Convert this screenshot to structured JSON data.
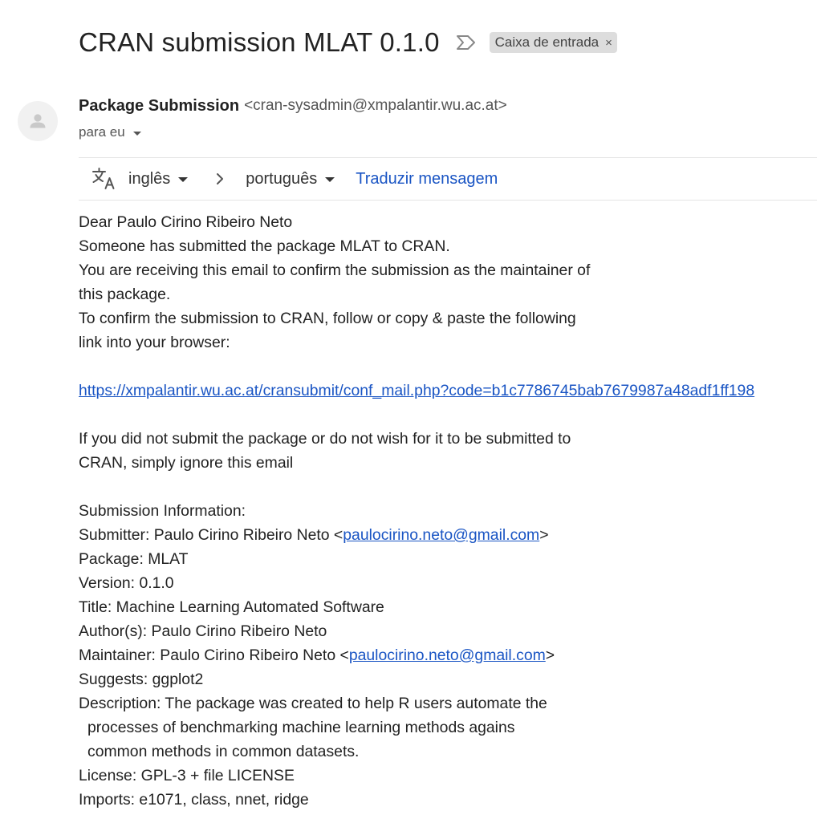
{
  "email": {
    "subject": "CRAN submission MLAT 0.1.0",
    "label": "Caixa de entrada",
    "label_remove_glyph": "×",
    "sender": {
      "name": "Package Submission",
      "email": "<cran-sysadmin@xmpalantir.wu.ac.at>"
    },
    "recipient": "para eu"
  },
  "translate_bar": {
    "source_language": "inglês",
    "target_language": "português",
    "translate_link": "Traduzir mensagem"
  },
  "body": {
    "greeting": "Dear Paulo Cirino Ribeiro Neto",
    "para1_line1": "Someone has submitted the package MLAT to CRAN.",
    "para1_line2": "You are receiving this email to confirm the submission as the maintainer of",
    "para1_line3": "this package.",
    "para1_line4": "To confirm the submission to CRAN, follow or copy & paste the following",
    "para1_line5": "link into your browser:",
    "confirm_link": "https://xmpalantir.wu.ac.at/cransubmit/conf_mail.php?code=b1c7786745bab7679987a48adf1ff198",
    "para2_line1": "If you did not submit the package or do not wish for it to be submitted to",
    "para2_line2": "CRAN, simply ignore this email",
    "info_heading": "Submission Information:",
    "submitter_prefix": "Submitter: Paulo Cirino Ribeiro Neto <",
    "submitter_email": "paulocirino.neto@gmail.com",
    "email_suffix": ">",
    "package": "Package: MLAT",
    "version": "Version: 0.1.0",
    "title": "Title: Machine Learning Automated Software",
    "authors": "Author(s): Paulo Cirino Ribeiro Neto",
    "maintainer_prefix": "Maintainer: Paulo Cirino Ribeiro Neto <",
    "maintainer_email": "paulocirino.neto@gmail.com",
    "suggests": "Suggests: ggplot2",
    "description_line1": "Description: The package was created to help R users automate the",
    "description_line2": "processes of benchmarking machine learning methods agains",
    "description_line3": "common methods in common datasets.",
    "license": "License: GPL-3 + file LICENSE",
    "imports": "Imports: e1071, class, nnet, ridge"
  },
  "icons": {
    "importance": "importance-marker-icon",
    "avatar": "person-avatar-icon",
    "translate": "translate-icon",
    "arrow": "chevron-right-icon"
  },
  "colors": {
    "link": "#1a55c4",
    "label_chip_bg": "#dddddd",
    "text": "#222222",
    "muted_text": "#555555"
  }
}
